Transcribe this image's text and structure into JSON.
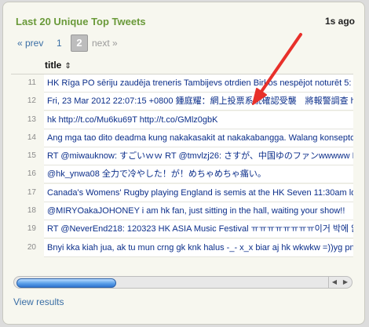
{
  "panel": {
    "title": "Last 20 Unique Top Tweets",
    "updated": "1s ago"
  },
  "pager": {
    "prev": "« prev",
    "page1": "1",
    "page2": "2",
    "next": "next »"
  },
  "table": {
    "column": "title",
    "sort_icon": "sort-icon",
    "rows": [
      {
        "num": "11",
        "text": "HK Rīga PO sēriju zaudēja treneris Tambijevs otrdien Birkos nespējot noturēt 5:"
      },
      {
        "num": "12",
        "text": "Fri, 23 Mar 2012 22:07:15 +0800 鍾庭耀：網上投票系統確認受襲　將報警調查 h"
      },
      {
        "num": "13",
        "text": "hk http://t.co/Mu6ku69T http://t.co/GMlz0gbK"
      },
      {
        "num": "14",
        "text": "Ang mga tao dito deadma kung nakakasakit at nakakabangga. Walang konsepto"
      },
      {
        "num": "15",
        "text": "RT @miwauknow: すごいｗｗ RT @tmvlzj26: さすが、中国ゆのファンwwwww H"
      },
      {
        "num": "16",
        "text": "@hk_ynwa08 全力で冷やした！が！めちゃめちゃ痛い。"
      },
      {
        "num": "17",
        "text": "Canada's Womens' Rugby playing England is semis at the HK Seven 11:30am lo"
      },
      {
        "num": "18",
        "text": "@MIRYOakaJOHONEY i am hk fan, just sitting in the hall, waiting your show!!"
      },
      {
        "num": "19",
        "text": "RT @NeverEnd218: 120323 HK ASIA Music Festival ㅠㅠㅠㅠㅠㅠㅠㅠ이거 박에 앉"
      },
      {
        "num": "20",
        "text": "Bnyi kka kiah jua, ak tu mun crng gk knk halus -_- x_x biar aj hk wkwkw =))yg pn"
      }
    ]
  },
  "footer": {
    "view_results": "View results"
  },
  "icons": {
    "scroll_left": "scroll-left-arrow",
    "scroll_right": "scroll-right-arrow",
    "annotation": "red-arrow"
  },
  "colors": {
    "title": "#6a9a3a",
    "link": "#3a6ea5",
    "row_text": "#0b2e8a",
    "arrow": "#e8302a"
  }
}
